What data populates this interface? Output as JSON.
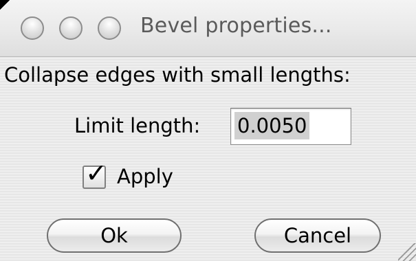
{
  "window": {
    "title": "Bevel properties..."
  },
  "dialog": {
    "heading": "Collapse edges with small lengths:",
    "limit_label": "Limit length:",
    "limit_value": "0.0050",
    "apply_checked": true,
    "checkmark_glyph": "✓",
    "apply_label": "Apply"
  },
  "buttons": {
    "ok_label": "Ok",
    "cancel_label": "Cancel"
  },
  "icons": {
    "close": "close-icon",
    "minimize": "minimize-icon",
    "zoom": "zoom-icon",
    "resize": "resize-grip-icon"
  },
  "colors": {
    "title_text": "#5a5a5a",
    "selection": "#d0d0d0",
    "button_border": "#6f6f6f"
  }
}
